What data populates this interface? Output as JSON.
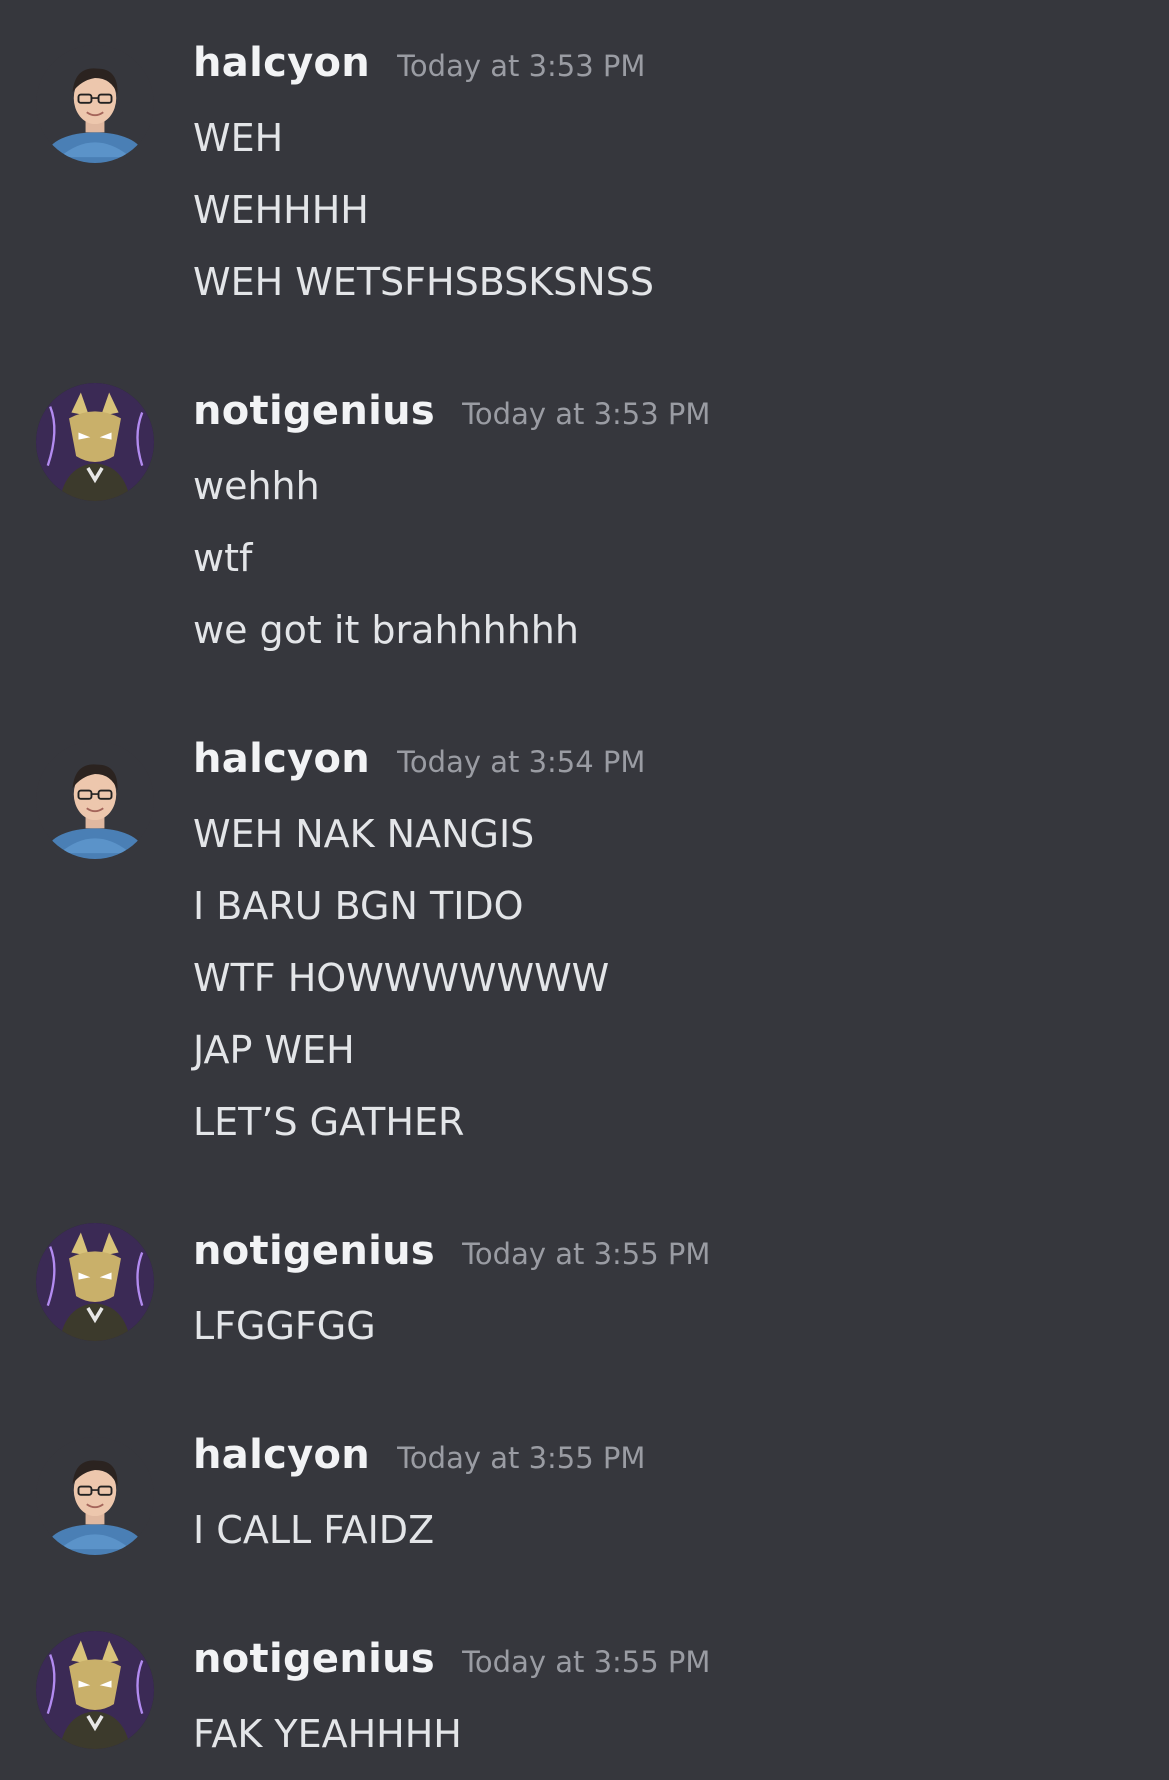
{
  "groups": [
    {
      "user": "halcyon",
      "avatar": "halcyon-avatar",
      "time": "Today at 3:53 PM",
      "lines": [
        "WEH",
        "WEHHHH",
        "WEH WETSFHSBSKSNSS"
      ]
    },
    {
      "user": "notigenius",
      "avatar": "notigenius-avatar",
      "time": "Today at 3:53 PM",
      "lines": [
        "wehhh",
        "wtf",
        "we got it brahhhhhh"
      ]
    },
    {
      "user": "halcyon",
      "avatar": "halcyon-avatar",
      "time": "Today at 3:54 PM",
      "lines": [
        "WEH NAK NANGIS",
        "I BARU BGN TIDO",
        "WTF HOWWWWWWW",
        "JAP WEH",
        "LET’S GATHER"
      ]
    },
    {
      "user": "notigenius",
      "avatar": "notigenius-avatar",
      "time": "Today at 3:55 PM",
      "lines": [
        "LFGGFGG"
      ]
    },
    {
      "user": "halcyon",
      "avatar": "halcyon-avatar",
      "time": "Today at 3:55 PM",
      "lines": [
        "I CALL FAIDZ"
      ]
    },
    {
      "user": "notigenius",
      "avatar": "notigenius-avatar",
      "time": "Today at 3:55 PM",
      "lines": [
        "FAK YEAHHHH"
      ]
    }
  ],
  "colors": {
    "background": "#36373d",
    "username": "#f2f3f5",
    "timestamp": "#9a9ca3",
    "message_text": "#e3e5e8"
  }
}
